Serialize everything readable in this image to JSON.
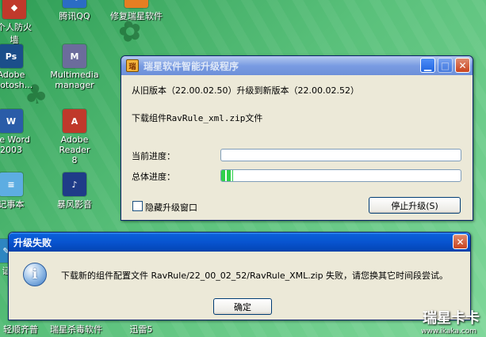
{
  "desktop": {
    "icons": [
      {
        "label": "个人防火\n墙",
        "glyph": "◆",
        "color": "#c0392b"
      },
      {
        "label": "腾讯QQ",
        "glyph": "Q",
        "color": "#2b6cc4"
      },
      {
        "label": "修复瑞星软件",
        "glyph": "R",
        "color": "#e67e22"
      },
      {
        "label": "Adobe\nPhotosh...",
        "glyph": "Ps",
        "color": "#1b4e8a"
      },
      {
        "label": "Multimedia\nmanager",
        "glyph": "M",
        "color": "#6c6c9c"
      },
      {
        "label": "ice Word\n2003",
        "glyph": "W",
        "color": "#2a5ca8"
      },
      {
        "label": "Adobe Reader\n8",
        "glyph": "A",
        "color": "#c0392b"
      },
      {
        "label": "记事本",
        "glyph": "≡",
        "color": "#5dade2"
      },
      {
        "label": "暴风影音",
        "glyph": "♪",
        "color": "#1f3c88"
      },
      {
        "label": "证",
        "glyph": "✎",
        "color": "#2e86c1"
      }
    ],
    "taskbar_labels": [
      "轻顺齐普",
      "瑞星杀毒软件",
      "迅雷5"
    ]
  },
  "upgrade_window": {
    "title": "瑞星软件智能升级程序",
    "version_text": "从旧版本（22.00.02.50）升级到新版本（22.00.02.52）",
    "download_text": "下载组件RavRule_xml.zip文件",
    "current_progress_label": "当前进度：",
    "total_progress_label": "总体进度：",
    "current_progress": 0,
    "total_progress": 0.05,
    "hide_window_label": "隐藏升级窗口",
    "stop_button_label": "停止升级(S)"
  },
  "error_dialog": {
    "title": "升级失败",
    "message": "下载新的组件配置文件 RavRule/22_00_02_52/RavRule_XML.zip 失败，请您换其它时间段尝试。",
    "ok_label": "确定"
  },
  "watermark": {
    "brand": "瑞星卡卡",
    "url": "www.ikaka.com"
  }
}
